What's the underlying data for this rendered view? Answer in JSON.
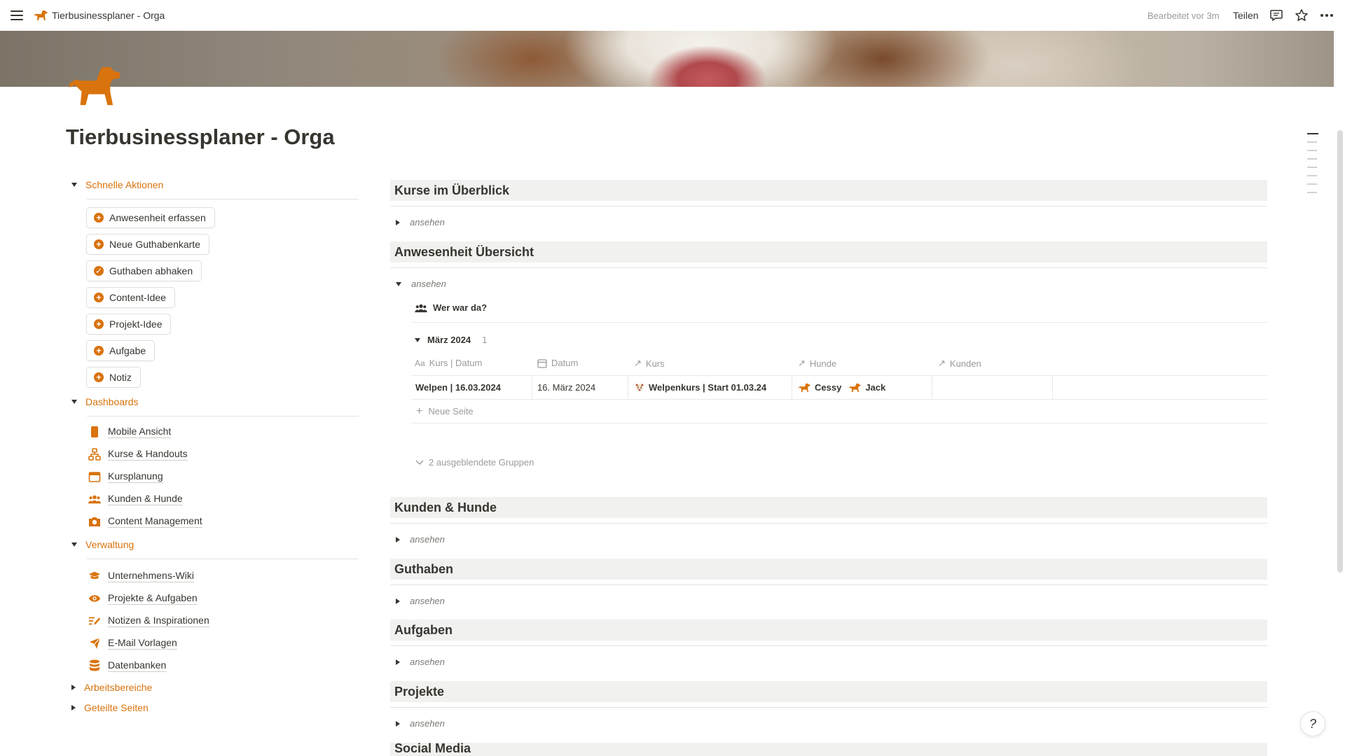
{
  "topbar": {
    "title": "Tierbusinessplaner - Orga",
    "edited": "Bearbeitet vor 3m",
    "share": "Teilen"
  },
  "page": {
    "title": "Tierbusinessplaner - Orga"
  },
  "colors": {
    "accent": "#d9730d",
    "text": "#37352f",
    "muted": "#9b9a97",
    "header_bg": "#f1f1ef"
  },
  "left": {
    "quick": {
      "label": "Schnelle Aktionen",
      "buttons": [
        {
          "label": "Anwesenheit erfassen",
          "icon": "plus-circle-icon"
        },
        {
          "label": "Neue Guthabenkarte",
          "icon": "plus-circle-icon"
        },
        {
          "label": "Guthaben abhaken",
          "icon": "check-circle-icon"
        },
        {
          "label": "Content-Idee",
          "icon": "plus-circle-icon"
        },
        {
          "label": "Projekt-Idee",
          "icon": "plus-circle-icon"
        },
        {
          "label": "Aufgabe",
          "icon": "plus-circle-icon"
        },
        {
          "label": "Notiz",
          "icon": "plus-circle-icon"
        }
      ]
    },
    "dashboards": {
      "label": "Dashboards",
      "items": [
        {
          "label": "Mobile Ansicht",
          "icon": "phone-icon"
        },
        {
          "label": "Kurse & Handouts",
          "icon": "hierarchy-icon"
        },
        {
          "label": "Kursplanung",
          "icon": "calendar-icon"
        },
        {
          "label": "Kunden & Hunde",
          "icon": "people-icon"
        },
        {
          "label": "Content Management",
          "icon": "camera-icon"
        }
      ]
    },
    "verwaltung": {
      "label": "Verwaltung",
      "items": [
        {
          "label": "Unternehmens-Wiki",
          "icon": "graduation-cap-icon"
        },
        {
          "label": "Projekte & Aufgaben",
          "icon": "eye-icon"
        },
        {
          "label": "Notizen & Inspirationen",
          "icon": "pencil-lines-icon"
        },
        {
          "label": "E-Mail Vorlagen",
          "icon": "send-icon"
        },
        {
          "label": "Datenbanken",
          "icon": "database-icon"
        }
      ]
    },
    "arbeitsbereiche": {
      "label": "Arbeitsbereiche"
    },
    "geteilte": {
      "label": "Geteilte Seiten"
    }
  },
  "right": {
    "toggle_label": "ansehen",
    "sections": [
      "Kurse im Überblick",
      "Anwesenheit Übersicht",
      "Kunden & Hunde",
      "Guthaben",
      "Aufgaben",
      "Projekte",
      "Social Media"
    ],
    "attendance": {
      "view_label": "Wer war da?",
      "group_label": "März 2024",
      "group_count": "1",
      "columns": [
        "Kurs | Datum",
        "Datum",
        "Kurs",
        "Hunde",
        "Kunden"
      ],
      "row": {
        "kurs_datum": "Welpen | 16.03.2024",
        "datum": "16. März 2024",
        "kurs": "Welpenkurs | Start 01.03.24",
        "hunde": [
          "Cessy",
          "Jack"
        ],
        "kunden": ""
      },
      "new_page": "Neue Seite",
      "hidden_groups": "2 ausgeblendete Gruppen"
    }
  }
}
